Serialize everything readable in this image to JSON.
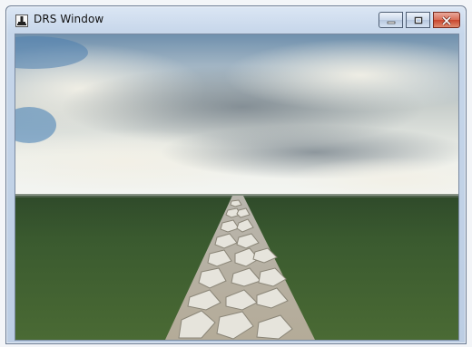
{
  "window": {
    "title": "DRS Window",
    "icon": "joystick-icon"
  },
  "caption_buttons": {
    "minimize_icon": "minimize-icon",
    "maximize_icon": "maximize-icon",
    "close_icon": "close-icon"
  },
  "scene": {
    "description_icon": "3d-viewport",
    "colors": {
      "sky_top": "#8faac2",
      "horizon": "#f3f4ef",
      "grass": "#3e5a2e",
      "path": "#c9c4b6"
    }
  }
}
